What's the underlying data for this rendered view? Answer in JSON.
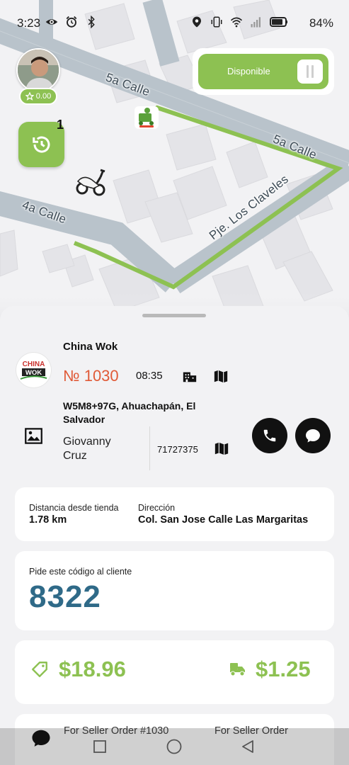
{
  "status_bar": {
    "time": "3:23",
    "battery": "84%",
    "left_icons": [
      "eye-icon",
      "alarm-icon",
      "bluetooth-icon"
    ],
    "right_icons": [
      "location-icon",
      "vibrate-icon",
      "wifi-icon",
      "signal-icon",
      "battery-icon"
    ]
  },
  "map": {
    "streets": [
      "5a Calle",
      "5a Calle",
      "4a Calle",
      "Pje. Los Claveles"
    ],
    "route_color": "#8dc152"
  },
  "driver": {
    "rating": "0.00",
    "history_count": "1"
  },
  "availability": {
    "label": "Disponible"
  },
  "order": {
    "store_name": "China Wok",
    "store_logo_text": [
      "CHINA",
      "WOK"
    ],
    "number": "№ 1030",
    "time": "08:35",
    "address": "W5M8+97G, Ahuachapán, El Salvador",
    "client_name": "Giovanny Cruz",
    "client_phone": "71727375"
  },
  "distance_card": {
    "distance_label": "Distancia desde tienda",
    "distance_value": "1.78 km",
    "address_label": "Dirección",
    "address_value": "Col. San Jose Calle Las Margaritas"
  },
  "code_card": {
    "label": "Pide este código al cliente",
    "code": "8322"
  },
  "money_card": {
    "total": "$18.96",
    "delivery_fee": "$1.25"
  },
  "chat_bar": {
    "message_left": "For Seller Order #1030",
    "message_right": "For Seller Order"
  },
  "colors": {
    "accent": "#8dc152",
    "order_number": "#e05a37",
    "code": "#2f6a88"
  }
}
